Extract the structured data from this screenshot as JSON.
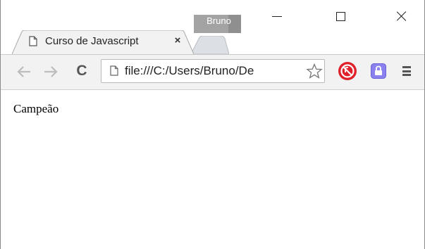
{
  "window": {
    "profile_name": "Bruno",
    "controls": [
      "minimize",
      "maximize",
      "close"
    ]
  },
  "tabs": [
    {
      "title": "Curso de Javascript",
      "icon": "page-icon",
      "active": true
    }
  ],
  "toolbar": {
    "back_icon": "arrow-left-icon",
    "forward_icon": "arrow-right-icon",
    "reload_symbol": "C",
    "url": "file:///C:/Users/Bruno/De",
    "bookmark_icon": "star-icon",
    "menu_icon": "hamburger-menu-icon"
  },
  "extensions": [
    {
      "icon": "red-extension-icon",
      "color": "#e0202a"
    },
    {
      "icon": "purple-lock-extension-icon",
      "color": "#7b6fe8"
    }
  ],
  "page": {
    "text": "Campeão"
  }
}
